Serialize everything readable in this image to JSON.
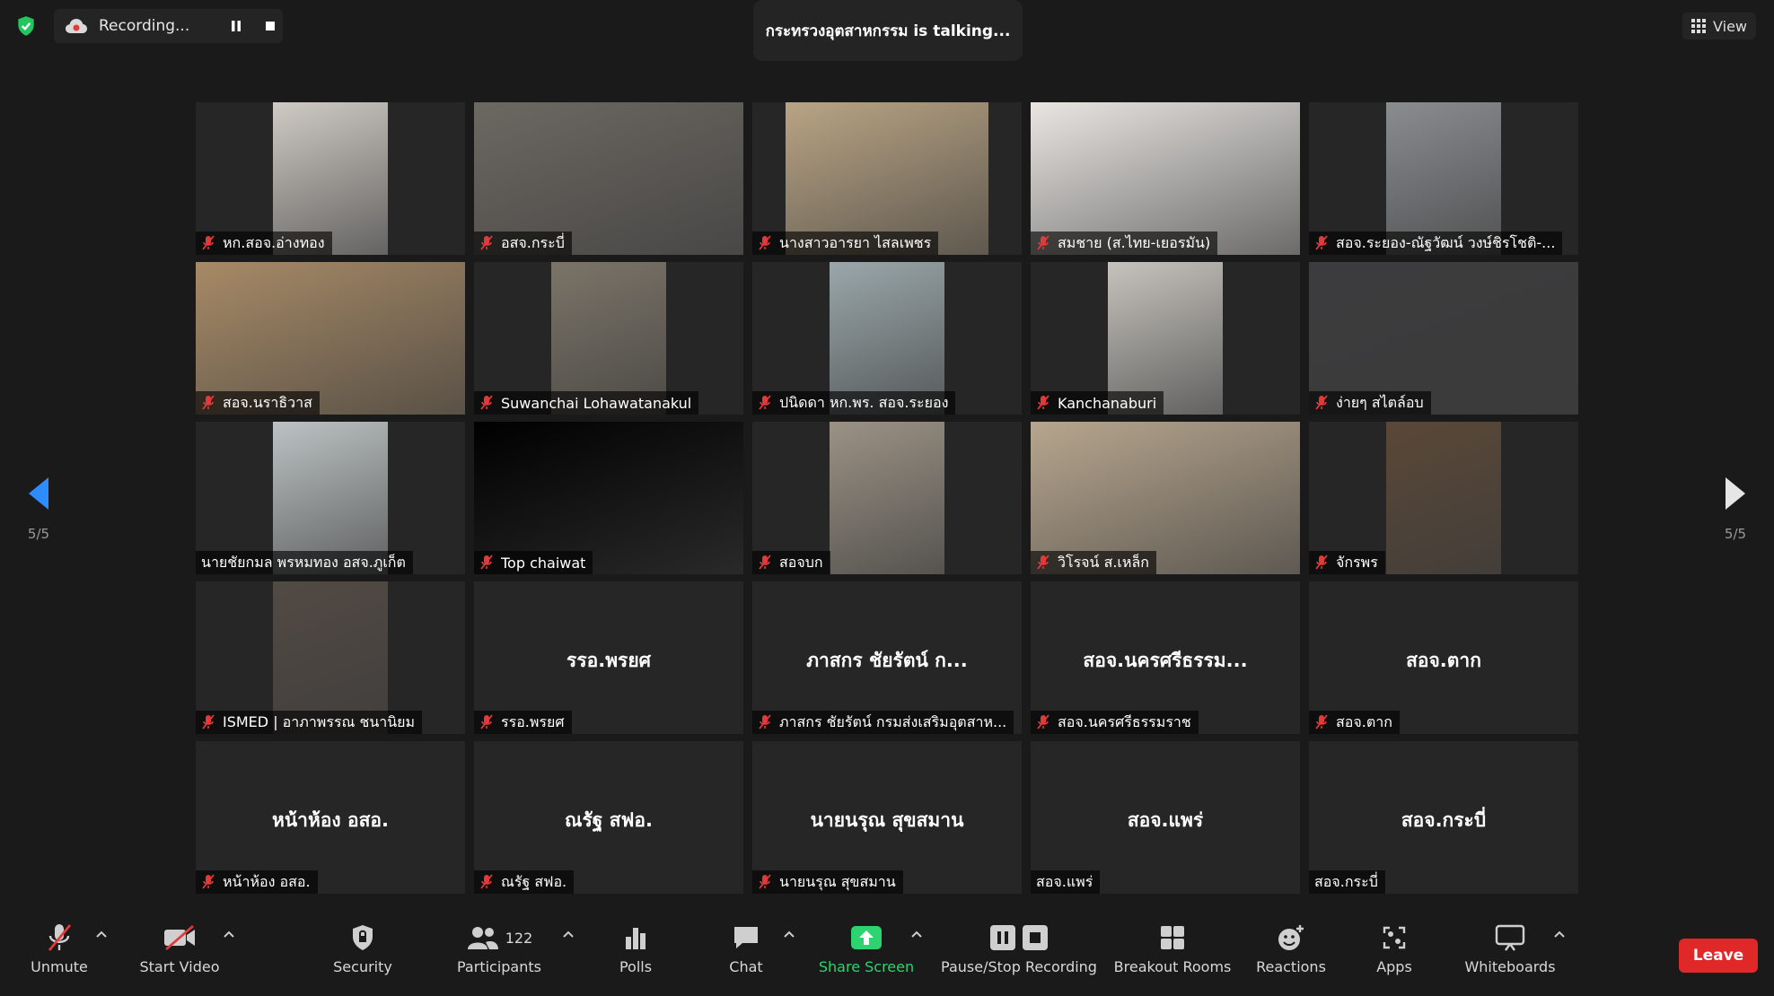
{
  "top": {
    "recording_label": "Recording...",
    "talking_label": "กระทรวงอุตสาหกรรม is  talking...",
    "view_label": "View"
  },
  "pager": {
    "left_label": "5/5",
    "right_label": "5/5"
  },
  "tiles": [
    {
      "name": "หก.สอจ.อ่างทอง",
      "center": "",
      "video": "#cfcac4"
    },
    {
      "name": "อสจ.กระบี่",
      "center": "",
      "video": "#6c6862"
    },
    {
      "name": "นางสาวอารยา ไสลเพชร",
      "center": "",
      "video": "#b9a484"
    },
    {
      "name": "สมชาย (ส.ไทย-เยอรมัน)",
      "center": "",
      "video": "#e9e6e2"
    },
    {
      "name": "สอจ.ระยอง-ณัฐวัฒน์ วงษ์ชิรโชติ-...",
      "center": "",
      "video": "#8a8c90"
    },
    {
      "name": "สอจ.นราธิวาส",
      "center": "",
      "video": "#a78a66"
    },
    {
      "name": "Suwanchai Lohawatanakul",
      "center": "",
      "video": "#7b7468"
    },
    {
      "name": "ปนิดดา หก.พร. สอจ.ระยอง",
      "center": "",
      "video": "#9aa7aa"
    },
    {
      "name": "Kanchanaburi",
      "center": "",
      "video": "#c6c3bd"
    },
    {
      "name": "ง่ายๆ สไตล์อบ",
      "center": "",
      "video": "#3c3c3e"
    },
    {
      "name": "นายชัยกมล พรหมทอง อสจ.ภูเก็ต",
      "center": "",
      "video": "#bcc2c3"
    },
    {
      "name": "Top chaiwat",
      "center": "",
      "video": "#000000"
    },
    {
      "name": "สอจบก",
      "center": "",
      "video": "#9b9285"
    },
    {
      "name": "วิโรจน์ ส.เหล็ก",
      "center": "",
      "video": "#b7a68e"
    },
    {
      "name": "จักรพร",
      "center": "",
      "video": "#5a4838"
    },
    {
      "name": "ISMED | อาภาพรรณ ชนานิยม",
      "center": "",
      "video": "#524a44"
    },
    {
      "name": "รรอ.พรยศ",
      "center": "รรอ.พรยศ",
      "video": ""
    },
    {
      "name": "ภาสกร ชัยรัตน์ กรมส่งเสริมอุตสาห...",
      "center": "ภาสกร ชัยรัตน์ ก...",
      "video": ""
    },
    {
      "name": "สอจ.นครศรีธรรมราช",
      "center": "สอจ.นครศรีธรรม...",
      "video": ""
    },
    {
      "name": "สอจ.ตาก",
      "center": "สอจ.ตาก",
      "video": ""
    },
    {
      "name": "หน้าห้อง อสอ.",
      "center": "หน้าห้อง อสอ.",
      "video": ""
    },
    {
      "name": "ณรัฐ สฟอ.",
      "center": "ณรัฐ สฟอ.",
      "video": ""
    },
    {
      "name": "นายนรุณ สุขสมาน",
      "center": "นายนรุณ สุขสมาน",
      "video": ""
    },
    {
      "name": "สอจ.แพร่",
      "center": "สอจ.แพร่",
      "video": ""
    },
    {
      "name": "สอจ.กระบี่",
      "center": "สอจ.กระบี่",
      "video": ""
    }
  ],
  "toolbar": {
    "unmute": "Unmute",
    "start_video": "Start Video",
    "security": "Security",
    "participants": "Participants",
    "participant_count": "122",
    "polls": "Polls",
    "chat": "Chat",
    "share_screen": "Share Screen",
    "pause_stop_recording": "Pause/Stop Recording",
    "breakout_rooms": "Breakout Rooms",
    "reactions": "Reactions",
    "apps": "Apps",
    "whiteboards": "Whiteboards",
    "leave": "Leave"
  },
  "colors": {
    "accent_blue": "#2d8cff",
    "share_green": "#2dd36f",
    "leave_red": "#e02828",
    "muted_red": "#e23a3a",
    "shield_green": "#22c55e"
  }
}
